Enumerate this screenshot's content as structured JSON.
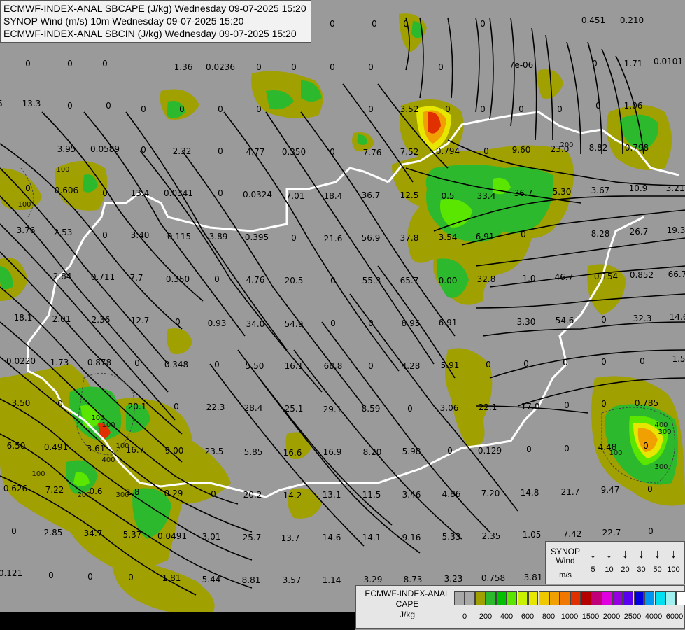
{
  "titles": [
    "ECMWF-INDEX-ANAL SBCAPE (J/kg) Wednesday 09-07-2025 15:20",
    "SYNOP Wind (m/s) 10m Wednesday 09-07-2025 15:20",
    "ECMWF-INDEX-ANAL SBCIN (J/kg) Wednesday 09-07-2025 15:20"
  ],
  "colors": {
    "background": "#9a9a9a",
    "border_line": "#ffffff",
    "streamline": "#000000",
    "cape_olive": "#a0a000",
    "cape_green": "#2db92d",
    "cape_lime": "#5ae600",
    "cape_yellow": "#e6e600",
    "cape_orange": "#f0a000",
    "cape_red": "#e03000"
  },
  "station_values": [
    {
      "label": "0"
    },
    {
      "label": "0"
    },
    {
      "label": "0"
    },
    {
      "label": "0"
    },
    {
      "label": "0.451"
    },
    {
      "label": "0.210"
    },
    {
      "label": "0"
    },
    {
      "label": "0"
    },
    {
      "label": "0"
    },
    {
      "label": "1.36"
    },
    {
      "label": "0.0236"
    },
    {
      "label": "0"
    },
    {
      "label": "0"
    },
    {
      "label": "0"
    },
    {
      "label": "0"
    },
    {
      "label": "0"
    },
    {
      "label": "7e-06"
    },
    {
      "label": "0"
    },
    {
      "label": "1.71"
    },
    {
      "label": "0.0101"
    },
    {
      "label": "5"
    },
    {
      "label": "13.3"
    },
    {
      "label": "0"
    },
    {
      "label": "0"
    },
    {
      "label": "0"
    },
    {
      "label": "0"
    },
    {
      "label": "0"
    },
    {
      "label": "0"
    },
    {
      "label": "0"
    },
    {
      "label": "3.52"
    },
    {
      "label": "0"
    },
    {
      "label": "0"
    },
    {
      "label": "0"
    },
    {
      "label": "0"
    },
    {
      "label": "0"
    },
    {
      "label": "1.06"
    },
    {
      "label": "3.95"
    },
    {
      "label": "0.0589"
    },
    {
      "label": "0"
    },
    {
      "label": "2.32"
    },
    {
      "label": "0"
    },
    {
      "label": "4.77"
    },
    {
      "label": "0.350"
    },
    {
      "label": "0"
    },
    {
      "label": "7.76"
    },
    {
      "label": "7.52"
    },
    {
      "label": "0.794"
    },
    {
      "label": "0"
    },
    {
      "label": "9.60"
    },
    {
      "label": "23.0"
    },
    {
      "label": "8.82"
    },
    {
      "label": "0.798"
    },
    {
      "label": "0"
    },
    {
      "label": "0.606"
    },
    {
      "label": "0"
    },
    {
      "label": "13.4"
    },
    {
      "label": "0.0341"
    },
    {
      "label": "0"
    },
    {
      "label": "0.0324"
    },
    {
      "label": "7.01"
    },
    {
      "label": "18.4"
    },
    {
      "label": "36.7"
    },
    {
      "label": "12.5"
    },
    {
      "label": "0.5"
    },
    {
      "label": "33.4"
    },
    {
      "label": "36.7"
    },
    {
      "label": "5.30"
    },
    {
      "label": "3.67"
    },
    {
      "label": "10.9"
    },
    {
      "label": "3.21"
    },
    {
      "label": "3.76"
    },
    {
      "label": "2.53"
    },
    {
      "label": "0"
    },
    {
      "label": "3.40"
    },
    {
      "label": "0.115"
    },
    {
      "label": "3.89"
    },
    {
      "label": "0.395"
    },
    {
      "label": "0"
    },
    {
      "label": "21.6"
    },
    {
      "label": "56.9"
    },
    {
      "label": "37.8"
    },
    {
      "label": "3.54"
    },
    {
      "label": "6.91"
    },
    {
      "label": "0"
    },
    {
      "label": "8.28"
    },
    {
      "label": "26.7"
    },
    {
      "label": "19.3"
    },
    {
      "label": "2.84"
    },
    {
      "label": "0.711"
    },
    {
      "label": "7.7"
    },
    {
      "label": "0.350"
    },
    {
      "label": "0"
    },
    {
      "label": "4.76"
    },
    {
      "label": "20.5"
    },
    {
      "label": "0"
    },
    {
      "label": "55.3"
    },
    {
      "label": "65.7"
    },
    {
      "label": "0.00"
    },
    {
      "label": "32.8"
    },
    {
      "label": "1.0"
    },
    {
      "label": "46.7"
    },
    {
      "label": "0.154"
    },
    {
      "label": "0.852"
    },
    {
      "label": "66.7"
    },
    {
      "label": "18.1"
    },
    {
      "label": "2.01"
    },
    {
      "label": "2.36"
    },
    {
      "label": "12.7"
    },
    {
      "label": "0"
    },
    {
      "label": "0.93"
    },
    {
      "label": "34.0"
    },
    {
      "label": "54.9"
    },
    {
      "label": "0"
    },
    {
      "label": "0"
    },
    {
      "label": "8.95"
    },
    {
      "label": "6.91"
    },
    {
      "label": "3.30"
    },
    {
      "label": "54.6"
    },
    {
      "label": "0"
    },
    {
      "label": "32.3"
    },
    {
      "label": "14.6"
    },
    {
      "label": "0.0220"
    },
    {
      "label": "1.73"
    },
    {
      "label": "0.878"
    },
    {
      "label": "0"
    },
    {
      "label": "0.348"
    },
    {
      "label": "0"
    },
    {
      "label": "5.50"
    },
    {
      "label": "16.1"
    },
    {
      "label": "68.8"
    },
    {
      "label": "0"
    },
    {
      "label": "4.28"
    },
    {
      "label": "5.91"
    },
    {
      "label": "0"
    },
    {
      "label": "0"
    },
    {
      "label": "0"
    },
    {
      "label": "0"
    },
    {
      "label": "0"
    },
    {
      "label": "1.5"
    },
    {
      "label": "3.50"
    },
    {
      "label": "0"
    },
    {
      "label": "20.1"
    },
    {
      "label": "0"
    },
    {
      "label": "22.3"
    },
    {
      "label": "28.4"
    },
    {
      "label": "25.1"
    },
    {
      "label": "29.1"
    },
    {
      "label": "8.59"
    },
    {
      "label": "0"
    },
    {
      "label": "3.06"
    },
    {
      "label": "22.1"
    },
    {
      "label": "17.0"
    },
    {
      "label": "0"
    },
    {
      "label": "0"
    },
    {
      "label": "0.785"
    },
    {
      "label": "6.50"
    },
    {
      "label": "0.491"
    },
    {
      "label": "3.61"
    },
    {
      "label": "16.7"
    },
    {
      "label": "9.00"
    },
    {
      "label": "23.5"
    },
    {
      "label": "5.85"
    },
    {
      "label": "16.6"
    },
    {
      "label": "16.9"
    },
    {
      "label": "8.20"
    },
    {
      "label": "5.98"
    },
    {
      "label": "0"
    },
    {
      "label": "0.129"
    },
    {
      "label": "0"
    },
    {
      "label": "0"
    },
    {
      "label": "4.48"
    },
    {
      "label": "0"
    },
    {
      "label": "0.626"
    },
    {
      "label": "7.22"
    },
    {
      "label": "0.6"
    },
    {
      "label": "1.8"
    },
    {
      "label": "0.29"
    },
    {
      "label": "0"
    },
    {
      "label": "20.2"
    },
    {
      "label": "14.2"
    },
    {
      "label": "13.1"
    },
    {
      "label": "11.5"
    },
    {
      "label": "3.46"
    },
    {
      "label": "4.86"
    },
    {
      "label": "7.20"
    },
    {
      "label": "14.8"
    },
    {
      "label": "21.7"
    },
    {
      "label": "9.47"
    },
    {
      "label": "0"
    },
    {
      "label": "0"
    },
    {
      "label": "2.85"
    },
    {
      "label": "34.7"
    },
    {
      "label": "5.37"
    },
    {
      "label": "0.0491"
    },
    {
      "label": "3.01"
    },
    {
      "label": "25.7"
    },
    {
      "label": "13.7"
    },
    {
      "label": "14.6"
    },
    {
      "label": "14.1"
    },
    {
      "label": "9.16"
    },
    {
      "label": "5.33"
    },
    {
      "label": "2.35"
    },
    {
      "label": "1.05"
    },
    {
      "label": "7.42"
    },
    {
      "label": "22.7"
    },
    {
      "label": "0"
    },
    {
      "label": "0.121"
    },
    {
      "label": "0"
    },
    {
      "label": "0"
    },
    {
      "label": "0"
    },
    {
      "label": "1.81"
    },
    {
      "label": "5.44"
    },
    {
      "label": "8.81"
    },
    {
      "label": "3.57"
    },
    {
      "label": "1.14"
    },
    {
      "label": "3.29"
    },
    {
      "label": "8.73"
    },
    {
      "label": "3.23"
    },
    {
      "label": "0.758"
    },
    {
      "label": "3.81"
    },
    {
      "label": "4.51"
    },
    {
      "label": "0"
    },
    {
      "label": "0"
    }
  ],
  "contour_labels": [
    "100",
    "100",
    "100",
    "100",
    "100",
    "200",
    "300",
    "400",
    "300",
    "400",
    "100",
    "300",
    "100",
    "200"
  ],
  "legend_wind": {
    "title_line1": "SYNOP",
    "title_line2": "Wind",
    "unit": "m/s",
    "items": [
      {
        "speed": "5",
        "arrow": "↓"
      },
      {
        "speed": "10",
        "arrow": "↓"
      },
      {
        "speed": "20",
        "arrow": "↓"
      },
      {
        "speed": "30",
        "arrow": "↓"
      },
      {
        "speed": "50",
        "arrow": "↓"
      },
      {
        "speed": "100",
        "arrow": "↓"
      }
    ]
  },
  "legend_cape": {
    "title_line1": "ECMWF-INDEX-ANAL",
    "title_line2": "CAPE",
    "unit": "J/kg",
    "swatches": [
      "#a8a8a8",
      "#a8a8a8",
      "#a0a000",
      "#2db92d",
      "#00c000",
      "#5ae600",
      "#c8f000",
      "#e6e600",
      "#f0c800",
      "#f0a000",
      "#f07800",
      "#e03000",
      "#b40000",
      "#c00078",
      "#e000e0",
      "#9600e0",
      "#5a00f0",
      "#0000e0",
      "#0096f0",
      "#00e0f0",
      "#a0f0f0",
      "#ffffff"
    ],
    "ticks": [
      "0",
      "200",
      "400",
      "600",
      "800",
      "1000",
      "1500",
      "2000",
      "2500",
      "4000",
      "6000"
    ]
  }
}
